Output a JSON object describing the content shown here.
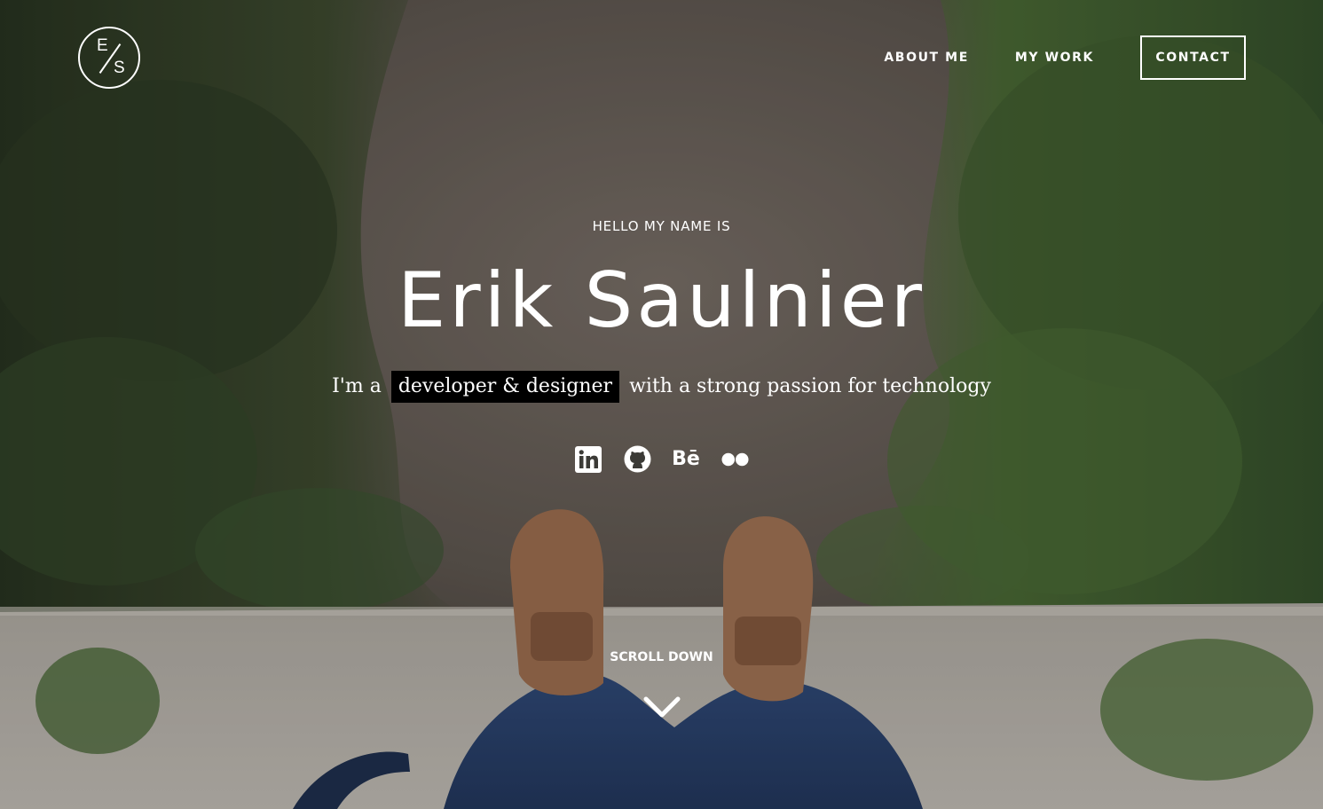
{
  "logo": {
    "top": "E",
    "bottom": "S"
  },
  "nav": {
    "about": "ABOUT ME",
    "work": "MY WORK",
    "contact": "CONTACT"
  },
  "hero": {
    "greeting": "HELLO MY NAME IS",
    "name": "Erik Saulnier",
    "tagline_prefix": "I'm a",
    "tagline_highlight": "developer & designer",
    "tagline_suffix": "with a strong passion for technology"
  },
  "social": [
    {
      "icon": "linkedin-icon"
    },
    {
      "icon": "github-icon"
    },
    {
      "icon": "behance-icon",
      "text": "Bē"
    },
    {
      "icon": "flickr-icon"
    }
  ],
  "scroll": {
    "label": "SCROLL DOWN",
    "icon": "chevron-down-icon"
  },
  "colors": {
    "text": "#ffffff",
    "highlight_bg": "#000000"
  }
}
